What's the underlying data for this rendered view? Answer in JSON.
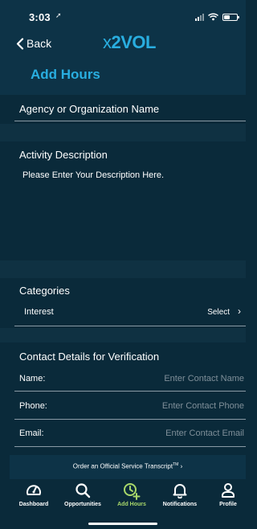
{
  "status_bar": {
    "time": "3:03"
  },
  "nav": {
    "back_label": "Back",
    "logo_prefix": "x",
    "logo_main": "2VOL"
  },
  "page": {
    "title": "Add Hours"
  },
  "agency": {
    "label": "Agency or Organization Name"
  },
  "activity": {
    "label": "Activity Description",
    "placeholder": "Please Enter Your Description Here."
  },
  "categories": {
    "label": "Categories",
    "rows": [
      {
        "label": "Interest",
        "value": "Select"
      }
    ]
  },
  "contact": {
    "label": "Contact Details for Verification",
    "fields": [
      {
        "label": "Name:",
        "placeholder": "Enter Contact Name"
      },
      {
        "label": "Phone:",
        "placeholder": "Enter Contact Phone"
      },
      {
        "label": "Email:",
        "placeholder": "Enter Contact Email"
      }
    ]
  },
  "transcript": {
    "link_text": "Order an Official Service Transcript",
    "trademark": "TM",
    "chevron": "›"
  },
  "tabs": [
    {
      "label": "Dashboard",
      "icon": "speedometer-icon"
    },
    {
      "label": "Opportunities",
      "icon": "search-icon"
    },
    {
      "label": "Add Hours",
      "icon": "clock-plus-icon",
      "active": true
    },
    {
      "label": "Notifications",
      "icon": "bell-icon"
    },
    {
      "label": "Profile",
      "icon": "person-icon"
    }
  ],
  "colors": {
    "accent": "#29aee0",
    "active_tab": "#a9d86a",
    "background": "#0a2a3a",
    "header": "#0d3347"
  }
}
